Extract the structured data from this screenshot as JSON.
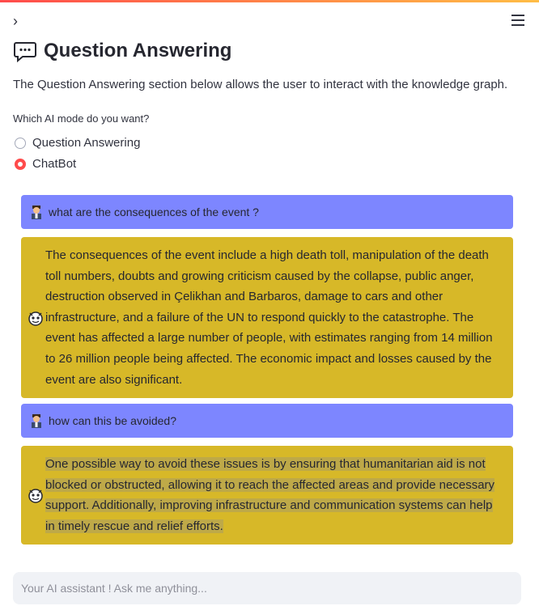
{
  "page": {
    "title": "Question Answering",
    "intro": "The Question Answering section below allows the user to interact with the knowledge graph.",
    "collapse_icon": "chevron-right-icon",
    "menu_icon": "hamburger-menu-icon"
  },
  "mode": {
    "label": "Which AI mode do you want?",
    "options": [
      "Question Answering",
      "ChatBot"
    ],
    "selected": "ChatBot"
  },
  "messages": [
    {
      "role": "user",
      "icon": "person-avatar-icon",
      "text": "what are the consequences of the event ?"
    },
    {
      "role": "bot",
      "icon": "robot-avatar-icon",
      "text": "The consequences of the event include a high death toll, manipulation of the death toll numbers, doubts and growing criticism caused by the collapse, public anger, destruction observed in Çelikhan and Barbaros, damage to cars and other infrastructure, and a failure of the UN to respond quickly to the catastrophe. The event has affected a large number of people, with estimates ranging from 14 million to 26 million people being affected. The economic impact and losses caused by the event are also significant."
    },
    {
      "role": "user",
      "icon": "person-avatar-icon",
      "text": "how can this be avoided?"
    },
    {
      "role": "bot",
      "icon": "robot-avatar-icon",
      "text": "One possible way to avoid these issues is by ensuring that humanitarian aid is not blocked or obstructed, allowing it to reach the affected areas and provide necessary support. Additionally, improving infrastructure and communication systems can help in timely rescue and relief efforts."
    }
  ],
  "chat_input": {
    "placeholder": "Your AI assistant ! Ask me anything..."
  },
  "colors": {
    "accent": "#ff4b4b",
    "user_bubble": "#7d86ff",
    "bot_bubble": "#d7b828"
  }
}
